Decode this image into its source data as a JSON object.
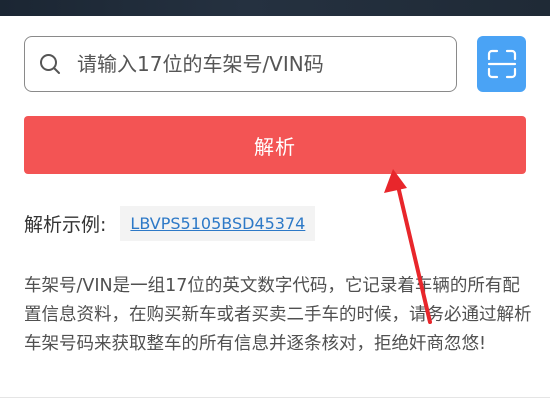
{
  "search": {
    "placeholder": "请输入17位的车架号/VIN码",
    "value": ""
  },
  "icons": {
    "search": "search-icon",
    "scan": "scan-icon"
  },
  "parse_button": {
    "label": "解析"
  },
  "example": {
    "label": "解析示例:",
    "code": "LBVPS5105BSD45374"
  },
  "description": "车架号/VIN是一组17位的英文数字代码，它记录着车辆的所有配置信息资料，在购买新车或者买卖二手车的时候，请务必通过解析车架号码来获取整车的所有信息并逐条核对，拒绝奸商忽悠!",
  "colors": {
    "primary_red": "#f35454",
    "scan_blue": "#4aa3f5",
    "link_blue": "#2d79c7",
    "annotation_arrow": "#e8262b"
  }
}
